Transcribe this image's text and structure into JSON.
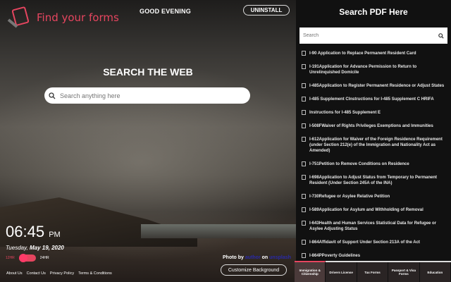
{
  "header": {
    "logo_text": "Find your forms",
    "greeting": "GOOD EVENING",
    "uninstall_label": "UNINSTALL"
  },
  "main": {
    "title": "SEARCH THE WEB",
    "search_placeholder": "Search anything here"
  },
  "clock": {
    "time": "06:45",
    "ampm": "PM",
    "weekday": "Tuesday,",
    "date": "May 19, 2020",
    "label_12": "12HR",
    "label_24": "24HR"
  },
  "footer": {
    "links": [
      "About Us",
      "Contact Us",
      "Privacy Policy",
      "Terms & Conditions"
    ]
  },
  "photo": {
    "prefix": "Photo by",
    "author": "author",
    "on": "on",
    "site": "unsplash"
  },
  "customize_label": "Customize Background",
  "panel": {
    "title": "Search PDF Here",
    "search_placeholder": "Search",
    "items": [
      "I-90 Application to Replace Permanent Resident Card",
      "I-191Application for Advance Permission to Return to Unrelinquished Domicile",
      "I-485Application to Register Permanent Residence or Adjust States",
      "I-485 Supplement CInstructions for I-485 Supplement C HRIFA",
      "Instructions for I-485 Supplement E",
      "I-508FWaiver of Rights Privileges Exemptions and Immunities",
      "I-612Application for Waiver of the Foreign Residence Requirement (under Section 212(e) of the Immigration and Nationality Act as Amended)",
      "I-751Petition to Remove Conditions on Residence",
      "I-698Application to Adjust Status from Temporary to Permanent Resident (Under Section 245A of the INA)",
      "I-730Refugee or Asylee Relative Petition",
      "I-589Application for Asylum and Withholding of Removal",
      "I-643Health and Human Services Statistical Data for Refugee or Asylee Adjusting Status",
      "I-864Affidavit of Support Under Section 213A of the Act",
      "I-864PPoverty Guidelines"
    ],
    "tabs": [
      "Immigration & Citizenship",
      "Drivers License",
      "Tax Forms",
      "Passport & Visa Forms",
      "Education"
    ]
  },
  "colors": {
    "accent": "#e5455f",
    "panel_bg": "#111111"
  }
}
